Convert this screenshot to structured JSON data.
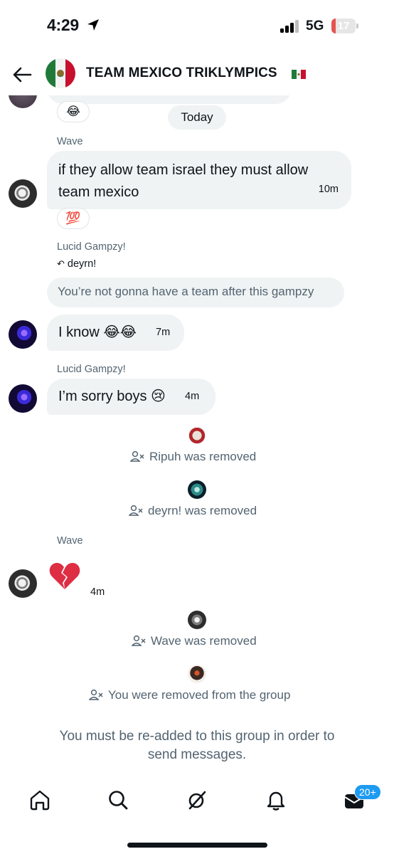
{
  "status": {
    "time": "4:29",
    "network": "5G",
    "battery": "17",
    "battery_fraction": 0.17
  },
  "header": {
    "title": "TEAM MEXICO TRIKLYMPICS"
  },
  "date_divider": "Today",
  "messages": [
    {
      "sender": "Wave",
      "text_line1": "if they allow team israel they must allow",
      "text_line2": "team mexico",
      "time": "10m",
      "reaction": "💯"
    },
    {
      "sender": "Lucid Gampzy!",
      "reply_to": "deyrn!",
      "quoted": "You’re not gonna have a team after this gampzy",
      "text": "I know 😂😂",
      "time": "7m"
    },
    {
      "sender": "Lucid Gampzy!",
      "text": "I’m sorry boys 😢",
      "time": "4m"
    },
    {
      "sender": "Wave",
      "text": "💔",
      "time": "4m"
    }
  ],
  "previous_reaction": "😂",
  "system_events": [
    "Ripuh was removed",
    "deyrn! was removed",
    "Wave was removed",
    "You were removed from the group"
  ],
  "footer_note_line1": "You must be re-added to this group in order to",
  "footer_note_line2": "send messages.",
  "nav": {
    "badge": "20+"
  },
  "colors": {
    "bubble": "#eff3f4",
    "secondary_text": "#536471",
    "accent": "#1d9bf0",
    "battery_low": "#e5554f"
  }
}
